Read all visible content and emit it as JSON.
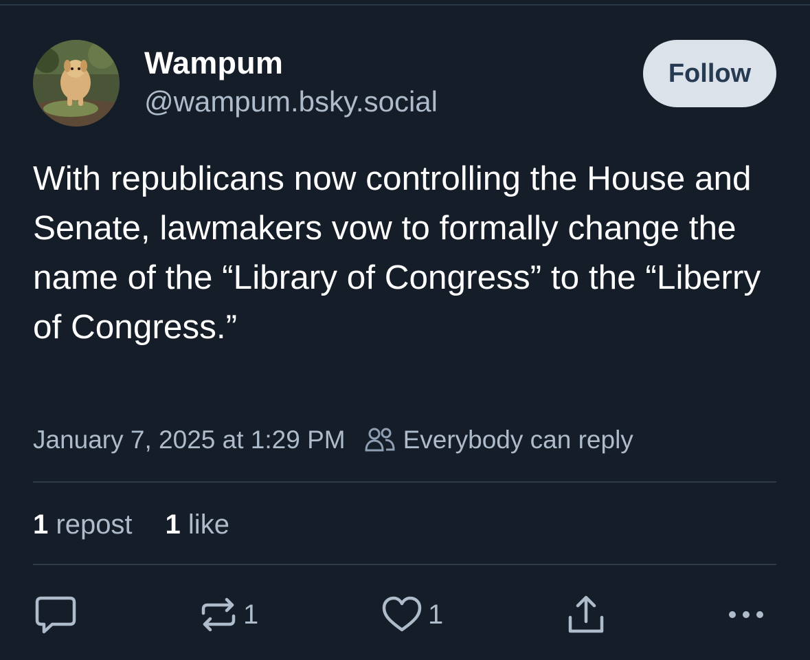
{
  "author": {
    "display_name": "Wampum",
    "handle": "@wampum.bsky.social",
    "avatar_icon": "dog-photo-avatar"
  },
  "follow_button": {
    "label": "Follow"
  },
  "post": {
    "text": "With republicans now controlling the House and Senate, lawmakers vow to formally change the name of the “Library of Congress” to the “Liberry of Congress.”",
    "timestamp": "January 7, 2025 at 1:29 PM",
    "reply_setting_icon": "people-icon",
    "reply_setting": "Everybody can reply"
  },
  "stats": {
    "reposts_count": "1",
    "reposts_label": "repost",
    "likes_count": "1",
    "likes_label": "like"
  },
  "actions": {
    "reply_icon": "comment-icon",
    "repost_icon": "repost-icon",
    "repost_count": "1",
    "like_icon": "heart-icon",
    "like_count": "1",
    "share_icon": "share-icon",
    "more_icon": "more-icon"
  },
  "colors": {
    "background": "#151d28",
    "text_primary": "#ffffff",
    "text_secondary": "#aebbca",
    "follow_bg": "#dce2ea",
    "follow_text": "#263a52",
    "divider": "#2c3a4a"
  }
}
